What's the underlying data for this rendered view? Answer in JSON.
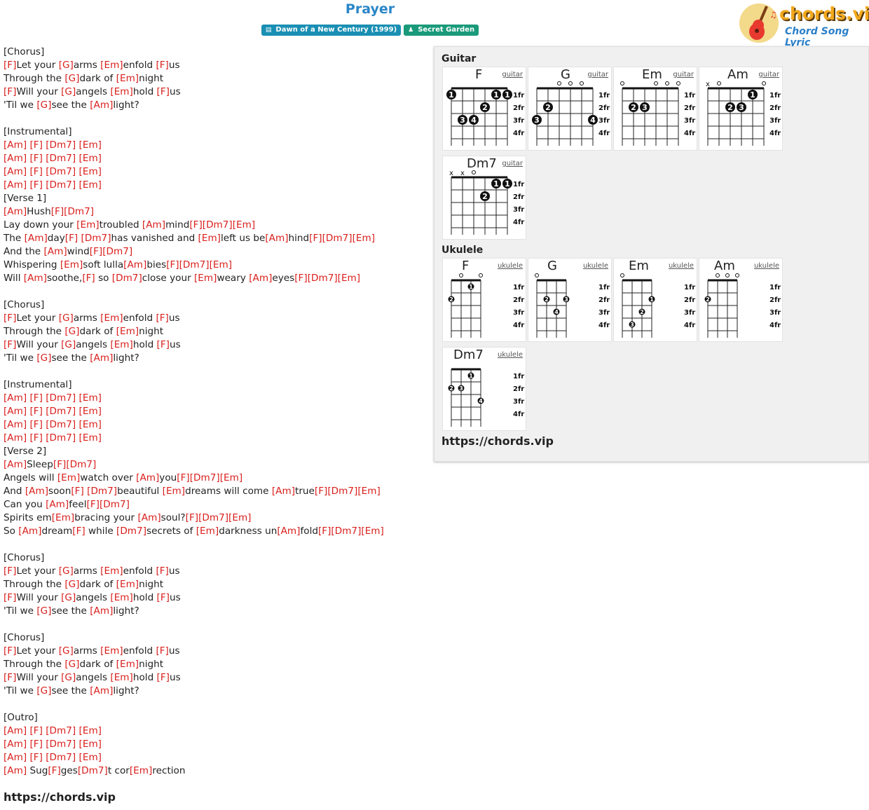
{
  "header": {
    "title": "Prayer",
    "album": "Dawn of a New Century (1999)",
    "artist": "Secret Garden",
    "logo": "chords.vip",
    "logo_sub": "Chord Song Lyric"
  },
  "lyrics": [
    "[Chorus]",
    "[F]Let your [G]arms [Em]enfold [F]us",
    "Through the [G]dark of [Em]night",
    "[F]Will your [G]angels [Em]hold [F]us",
    "'Til we [G]see the [Am]light?",
    "",
    "[Instrumental]",
    "[Am] [F] [Dm7] [Em]",
    "[Am] [F] [Dm7] [Em]",
    "[Am] [F] [Dm7] [Em]",
    "[Am] [F] [Dm7] [Em]",
    "[Verse 1]",
    "[Am]Hush[F][Dm7]",
    "Lay down your [Em]troubled [Am]mind[F][Dm7][Em]",
    "The [Am]day[F] [Dm7]has vanished and [Em]left us be[Am]hind[F][Dm7][Em]",
    "And the [Am]wind[F][Dm7]",
    "Whispering [Em]soft lulla[Am]bies[F][Dm7][Em]",
    "Will [Am]soothe,[F] so [Dm7]close your [Em]weary [Am]eyes[F][Dm7][Em]",
    "",
    "[Chorus]",
    "[F]Let your [G]arms [Em]enfold [F]us",
    "Through the [G]dark of [Em]night",
    "[F]Will your [G]angels [Em]hold [F]us",
    "'Til we [G]see the [Am]light?",
    "",
    "[Instrumental]",
    "[Am] [F] [Dm7] [Em]",
    "[Am] [F] [Dm7] [Em]",
    "[Am] [F] [Dm7] [Em]",
    "[Am] [F] [Dm7] [Em]",
    "[Verse 2]",
    "[Am]Sleep[F][Dm7]",
    "Angels will [Em]watch over [Am]you[F][Dm7][Em]",
    "And [Am]soon[F] [Dm7]beautiful [Em]dreams will come [Am]true[F][Dm7][Em]",
    "Can you [Am]feel[F][Dm7]",
    "Spirits em[Em]bracing your [Am]soul?[F][Dm7][Em]",
    "So [Am]dream[F] while [Dm7]secrets of [Em]darkness un[Am]fold[F][Dm7][Em]",
    "",
    "[Chorus]",
    "[F]Let your [G]arms [Em]enfold [F]us",
    "Through the [G]dark of [Em]night",
    "[F]Will your [G]angels [Em]hold [F]us",
    "'Til we [G]see the [Am]light?",
    "",
    "[Chorus]",
    "[F]Let your [G]arms [Em]enfold [F]us",
    "Through the [G]dark of [Em]night",
    "[F]Will your [G]angels [Em]hold [F]us",
    "'Til we [G]see the [Am]light?",
    "",
    "[Outro]",
    "[Am] [F] [Dm7] [Em]",
    "[Am] [F] [Dm7] [Em]",
    "[Am] [F] [Dm7] [Em]",
    "[Am] Sug[F]ges[Dm7]t cor[Em]rection"
  ],
  "chord_names": [
    "F",
    "G",
    "Em",
    "Am",
    "Dm7"
  ],
  "footer_url": "https://chords.vip",
  "panel": {
    "guitar_title": "Guitar",
    "ukulele_title": "Ukulele",
    "url": "https://chords.vip",
    "fret_labels": [
      "1fr",
      "2fr",
      "3fr",
      "4fr"
    ],
    "guitar": [
      {
        "name": "F",
        "type": "guitar",
        "markers": [
          "",
          "",
          "",
          "",
          "",
          ""
        ],
        "dots": [
          {
            "s": 1,
            "f": 1,
            "n": "1"
          },
          {
            "s": 5,
            "f": 1,
            "n": "1"
          },
          {
            "s": 6,
            "f": 1,
            "n": "1"
          },
          {
            "s": 4,
            "f": 2,
            "n": "2"
          },
          {
            "s": 2,
            "f": 3,
            "n": "3"
          },
          {
            "s": 3,
            "f": 3,
            "n": "4"
          }
        ]
      },
      {
        "name": "G",
        "type": "guitar",
        "markers": [
          "",
          "",
          "o",
          "o",
          "o",
          ""
        ],
        "dots": [
          {
            "s": 2,
            "f": 2,
            "n": "2"
          },
          {
            "s": 1,
            "f": 3,
            "n": "3"
          },
          {
            "s": 6,
            "f": 3,
            "n": "4"
          }
        ]
      },
      {
        "name": "Em",
        "type": "guitar",
        "markers": [
          "o",
          "",
          "",
          "o",
          "o",
          "o"
        ],
        "dots": [
          {
            "s": 2,
            "f": 2,
            "n": "2"
          },
          {
            "s": 3,
            "f": 2,
            "n": "3"
          }
        ]
      },
      {
        "name": "Am",
        "type": "guitar",
        "markers": [
          "x",
          "o",
          "",
          "",
          "",
          "o"
        ],
        "dots": [
          {
            "s": 5,
            "f": 1,
            "n": "1"
          },
          {
            "s": 3,
            "f": 2,
            "n": "2"
          },
          {
            "s": 4,
            "f": 2,
            "n": "3"
          }
        ]
      },
      {
        "name": "Dm7",
        "type": "guitar",
        "markers": [
          "x",
          "x",
          "o",
          "",
          "",
          ""
        ],
        "dots": [
          {
            "s": 5,
            "f": 1,
            "n": "1"
          },
          {
            "s": 6,
            "f": 1,
            "n": "1"
          },
          {
            "s": 4,
            "f": 2,
            "n": "2"
          }
        ]
      }
    ],
    "ukulele": [
      {
        "name": "F",
        "type": "ukulele",
        "markers": [
          "",
          "o",
          "",
          "o"
        ],
        "dots": [
          {
            "s": 3,
            "f": 1,
            "n": "1"
          },
          {
            "s": 1,
            "f": 2,
            "n": "2"
          }
        ]
      },
      {
        "name": "G",
        "type": "ukulele",
        "markers": [
          "o",
          "",
          "",
          ""
        ],
        "dots": [
          {
            "s": 2,
            "f": 2,
            "n": "2"
          },
          {
            "s": 4,
            "f": 2,
            "n": "3"
          },
          {
            "s": 3,
            "f": 3,
            "n": "4"
          }
        ]
      },
      {
        "name": "Em",
        "type": "ukulele",
        "markers": [
          "o",
          "",
          "",
          ""
        ],
        "dots": [
          {
            "s": 4,
            "f": 2,
            "n": "1"
          },
          {
            "s": 3,
            "f": 3,
            "n": "2"
          },
          {
            "s": 2,
            "f": 4,
            "n": "3"
          }
        ]
      },
      {
        "name": "Am",
        "type": "ukulele",
        "markers": [
          "",
          "o",
          "o",
          "o"
        ],
        "dots": [
          {
            "s": 1,
            "f": 2,
            "n": "2"
          }
        ]
      },
      {
        "name": "Dm7",
        "type": "ukulele",
        "markers": [
          "",
          "",
          "",
          ""
        ],
        "dots": [
          {
            "s": 3,
            "f": 1,
            "n": "1"
          },
          {
            "s": 1,
            "f": 2,
            "n": "2"
          },
          {
            "s": 2,
            "f": 2,
            "n": "3"
          },
          {
            "s": 4,
            "f": 3,
            "n": "4"
          }
        ]
      }
    ]
  }
}
